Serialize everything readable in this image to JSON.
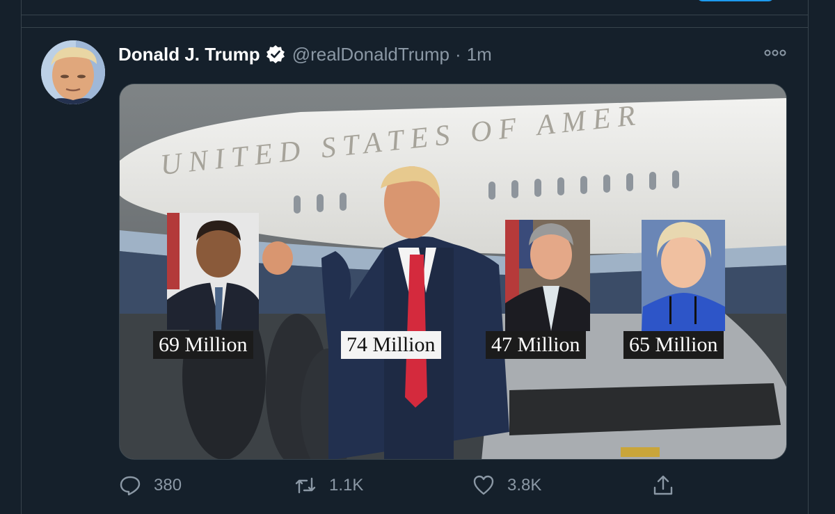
{
  "tweet": {
    "author_name": "Donald J. Trump",
    "handle": "@realDonaldTrump",
    "separator": "·",
    "time": "1m"
  },
  "media": {
    "labels": [
      "69 Million",
      "74 Million",
      "47 Million",
      "65 Million"
    ]
  },
  "actions": {
    "replies": "380",
    "retweets": "1.1K",
    "likes": "3.8K"
  },
  "colors": {
    "background": "#15202b",
    "secondary_text": "#8b98a5",
    "verified": "#ffffff"
  },
  "icons": [
    "verified-badge-icon",
    "more-options-icon",
    "reply-icon",
    "retweet-icon",
    "like-icon",
    "share-icon"
  ]
}
